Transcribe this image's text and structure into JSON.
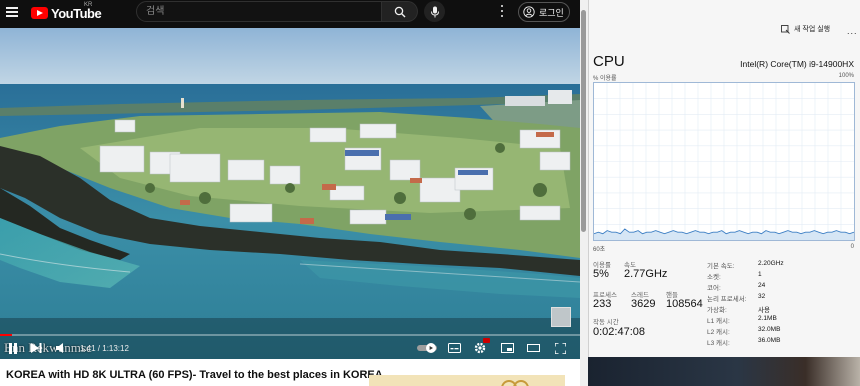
{
  "youtube": {
    "logo_text": "YouTube",
    "region": "KR",
    "search_placeholder": "검색",
    "login_label": "로그인",
    "video": {
      "overlay_title": "Enn Rekwanmsc",
      "time": "1:41 / 1:13:12",
      "progress_fraction": 0.02
    },
    "title": "KOREA with HD 8K ULTRA (60 FPS)- Travel to the best places in KOREA"
  },
  "task_manager": {
    "new_task_label": "새 작업 실행",
    "more_label": "...",
    "heading": "CPU",
    "cpu_name": "Intel(R) Core(TM) i9-14900HX",
    "graph": {
      "y_label": "% 이용률",
      "y_max": "100%",
      "x_label": "60초",
      "x_min": "0"
    },
    "stats": [
      {
        "label": "이용률",
        "value": "5%"
      },
      {
        "label": "속도",
        "value": "2.77GHz"
      },
      {
        "label": "프로세스",
        "value": "233"
      },
      {
        "label": "스레드",
        "value": "3629"
      },
      {
        "label": "핸들",
        "value": "108564"
      },
      {
        "label": "작동 시간",
        "value": "0:02:47:08"
      }
    ],
    "specs": [
      {
        "key": "기본 속도:",
        "value": "2.20GHz"
      },
      {
        "key": "소켓:",
        "value": "1"
      },
      {
        "key": "코어:",
        "value": "24"
      },
      {
        "key": "논리 프로세서:",
        "value": "32"
      },
      {
        "key": "가상화:",
        "value": "사용"
      },
      {
        "key": "L1 캐시:",
        "value": "2.1MB"
      },
      {
        "key": "L2 캐시:",
        "value": "32.0MB"
      },
      {
        "key": "L3 캐시:",
        "value": "36.0MB"
      }
    ],
    "utilization_history": [
      4,
      5,
      4,
      6,
      5,
      5,
      4,
      7,
      5,
      5,
      6,
      4,
      5,
      5,
      6,
      5,
      4,
      5,
      6,
      5,
      5,
      4,
      5,
      6,
      5,
      5,
      4,
      5,
      5,
      6,
      4,
      5,
      5,
      6,
      5,
      4,
      5,
      5,
      4,
      6,
      5,
      5,
      4,
      5,
      6,
      5,
      5,
      4,
      5,
      5,
      6,
      5,
      4,
      5,
      5,
      6,
      5,
      5,
      4,
      5
    ]
  },
  "colors": {
    "yt_header": "#0f0f0f",
    "yt_red": "#ff0000",
    "graph_line": "#3d7fc4",
    "graph_border": "#9fb8d6"
  }
}
